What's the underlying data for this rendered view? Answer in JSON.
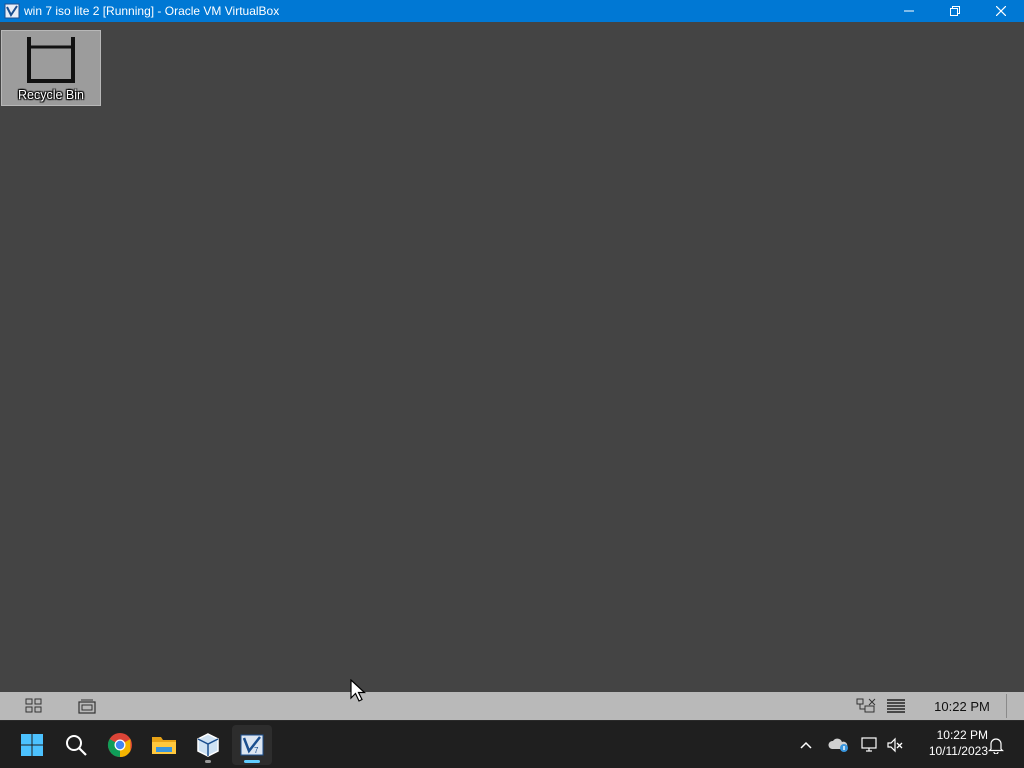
{
  "window": {
    "title": "win 7 iso lite 2 [Running] - Oracle VM VirtualBox",
    "icon": "virtualbox-icon",
    "controls": [
      "minimize-icon",
      "restore-icon",
      "close-icon"
    ]
  },
  "desktop": {
    "background_color": "#444444",
    "icons": [
      {
        "label": "Recycle Bin",
        "icon": "recycle-bin-icon"
      }
    ]
  },
  "guest_taskbar": {
    "background_color": "#b9b9b9",
    "left_buttons": [
      "tiles-icon",
      "window-stack-icon"
    ],
    "tray_icons": [
      "network-icon",
      "keyboard-icon"
    ],
    "clock": "10:22 PM"
  },
  "host_taskbar": {
    "background_color": "#1f1f1f",
    "apps": [
      {
        "name": "Start",
        "icon": "windows-start-icon"
      },
      {
        "name": "Search",
        "icon": "search-icon"
      },
      {
        "name": "Google Chrome",
        "icon": "chrome-icon"
      },
      {
        "name": "File Explorer",
        "icon": "folder-icon"
      },
      {
        "name": "VirtualBox Manager",
        "icon": "virtualbox-manager-icon",
        "running": true
      },
      {
        "name": "VirtualBox VM",
        "icon": "virtualbox-vm-icon",
        "active": true
      }
    ],
    "tray": [
      "chevron-up-icon",
      "onedrive-icon",
      "display-icon",
      "volume-muted-icon"
    ],
    "time": "10:22 PM",
    "date": "10/11/2023",
    "notification_icon": "bell-icon",
    "accent_color": "#60cdff"
  }
}
